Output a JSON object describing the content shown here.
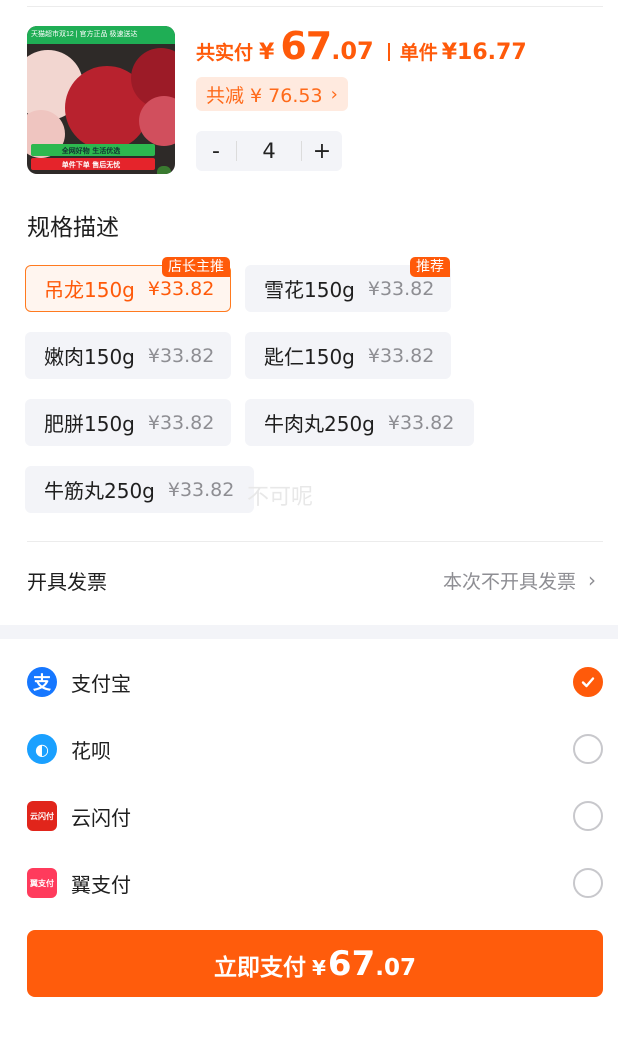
{
  "product": {
    "image_banner_text": "天猫超市双12 | 官方正品 极速送达",
    "image_footer_green": "全网好物 生活优选",
    "image_footer_red": "单件下单 售后无忧",
    "price_label": "共实付",
    "price_symbol": "¥",
    "price_integer": "67",
    "price_decimal": ".07",
    "unit_label": "单件",
    "unit_price": "¥16.77",
    "discount_text": "共减 ¥ 76.53",
    "discount_chevron": "›",
    "quantity": "4",
    "minus_label": "-",
    "plus_label": "+"
  },
  "spec": {
    "title": "规格描述",
    "options": [
      {
        "name": "吊龙150g",
        "price": "¥33.82",
        "badge": "店长主推",
        "selected": true
      },
      {
        "name": "雪花150g",
        "price": "¥33.82",
        "badge": "推荐",
        "selected": false
      },
      {
        "name": "嫩肉150g",
        "price": "¥33.82",
        "badge": "",
        "selected": false
      },
      {
        "name": "匙仁150g",
        "price": "¥33.82",
        "badge": "",
        "selected": false
      },
      {
        "name": "肥胼150g",
        "price": "¥33.82",
        "badge": "",
        "selected": false
      },
      {
        "name": "牛肉丸250g",
        "price": "¥33.82",
        "badge": "",
        "selected": false
      },
      {
        "name": "牛筋丸250g",
        "price": "¥33.82",
        "badge": "",
        "selected": false
      }
    ],
    "watermark": "不可呢"
  },
  "invoice": {
    "label": "开具发票",
    "value": "本次不开具发票",
    "chevron": "›"
  },
  "payment": {
    "methods": [
      {
        "label": "支付宝",
        "icon": "alipay-icon",
        "icon_glyph": "支",
        "color": "#1677ff",
        "checked": true
      },
      {
        "label": "花呗",
        "icon": "huabei-icon",
        "icon_glyph": "◐",
        "color": "#1aa0ff",
        "checked": false
      },
      {
        "label": "云闪付",
        "icon": "unionpay-icon",
        "icon_glyph": "云闪付",
        "color": "#e1251b",
        "checked": false
      },
      {
        "label": "翼支付",
        "icon": "bestpay-icon",
        "icon_glyph": "翼支付",
        "color": "#ff3b5c",
        "checked": false
      }
    ],
    "accent_color": "#ff5a0a"
  },
  "pay_button": {
    "label": "立即支付",
    "symbol": "¥",
    "integer": "67",
    "decimal": ".07"
  }
}
